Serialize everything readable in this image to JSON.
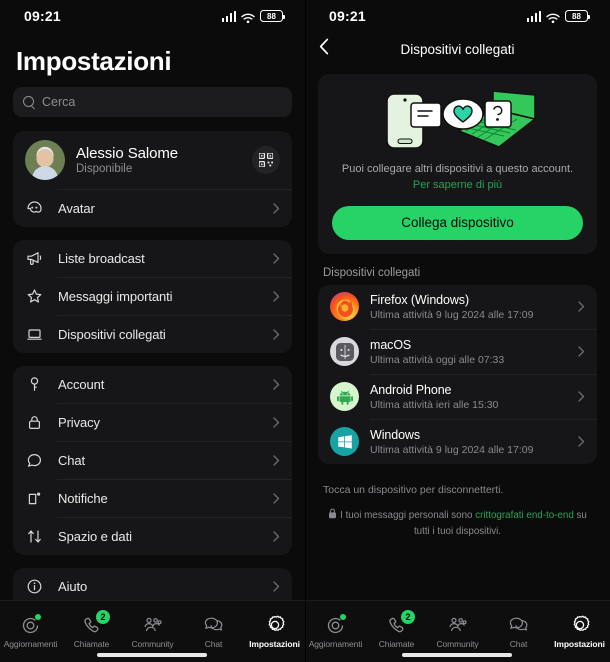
{
  "status_bar": {
    "time": "09:21",
    "battery": "88",
    "signal_icon": "cellular-bars-icon",
    "wifi_icon": "wifi-icon",
    "battery_icon": "battery-icon"
  },
  "left": {
    "title": "Impostazioni",
    "search": {
      "placeholder": "Cerca",
      "icon": "search-icon"
    },
    "profile": {
      "name": "Alessio Salome",
      "status": "Disponibile",
      "qr_icon": "qr-code-icon",
      "avatar_icon": "avatar-image"
    },
    "avatar_row": {
      "label": "Avatar",
      "icon": "smiley-avatar-icon"
    },
    "group_a": [
      {
        "label": "Liste broadcast",
        "icon": "megaphone-icon"
      },
      {
        "label": "Messaggi importanti",
        "icon": "star-icon"
      },
      {
        "label": "Dispositivi collegati",
        "icon": "laptop-icon"
      }
    ],
    "group_b": [
      {
        "label": "Account",
        "icon": "key-icon"
      },
      {
        "label": "Privacy",
        "icon": "lock-icon"
      },
      {
        "label": "Chat",
        "icon": "chat-bubble-icon"
      },
      {
        "label": "Notifiche",
        "icon": "bell-icon"
      },
      {
        "label": "Spazio e dati",
        "icon": "arrows-updown-icon"
      }
    ],
    "group_c": [
      {
        "label": "Aiuto",
        "icon": "info-circle-icon"
      }
    ]
  },
  "right": {
    "nav": {
      "title": "Dispositivi collegati",
      "back_icon": "chevron-left-icon"
    },
    "hero": {
      "illustration": "devices-heart-illustration",
      "text_before": "Puoi collegare altri dispositivi a questo account. ",
      "link": "Per saperne di più",
      "cta": "Collega dispositivo"
    },
    "section_label": "Dispositivi collegati",
    "devices": [
      {
        "name": "Firefox (Windows)",
        "activity": "Ultima attività 9 lug 2024 alle 17:09",
        "icon": "firefox-icon"
      },
      {
        "name": "macOS",
        "activity": "Ultima attività oggi alle 07:33",
        "icon": "macos-finder-icon"
      },
      {
        "name": "Android Phone",
        "activity": "Ultima attività ieri alle 15:30",
        "icon": "android-icon"
      },
      {
        "name": "Windows",
        "activity": "Ultima attività 9 lug 2024 alle 17:09",
        "icon": "windows-icon"
      }
    ],
    "hint": "Tocca un dispositivo per disconnetterti.",
    "e2e": {
      "icon": "lock-icon",
      "before": "I tuoi messaggi personali sono ",
      "link": "crittografati end-to-end",
      "after": " su tutti i tuoi dispositivi."
    }
  },
  "tabs": [
    {
      "label": "Aggiornamenti",
      "icon": "updates-icon",
      "active": false,
      "dot": true
    },
    {
      "label": "Chiamate",
      "icon": "phone-icon",
      "active": false,
      "badge": "2"
    },
    {
      "label": "Community",
      "icon": "community-icon",
      "active": false
    },
    {
      "label": "Chat",
      "icon": "chats-icon",
      "active": false
    },
    {
      "label": "Impostazioni",
      "icon": "gear-icon",
      "active": true
    }
  ],
  "colors": {
    "accent": "#25d366",
    "link": "#25a35a",
    "card": "#161618",
    "bg": "#0b0b0b"
  }
}
